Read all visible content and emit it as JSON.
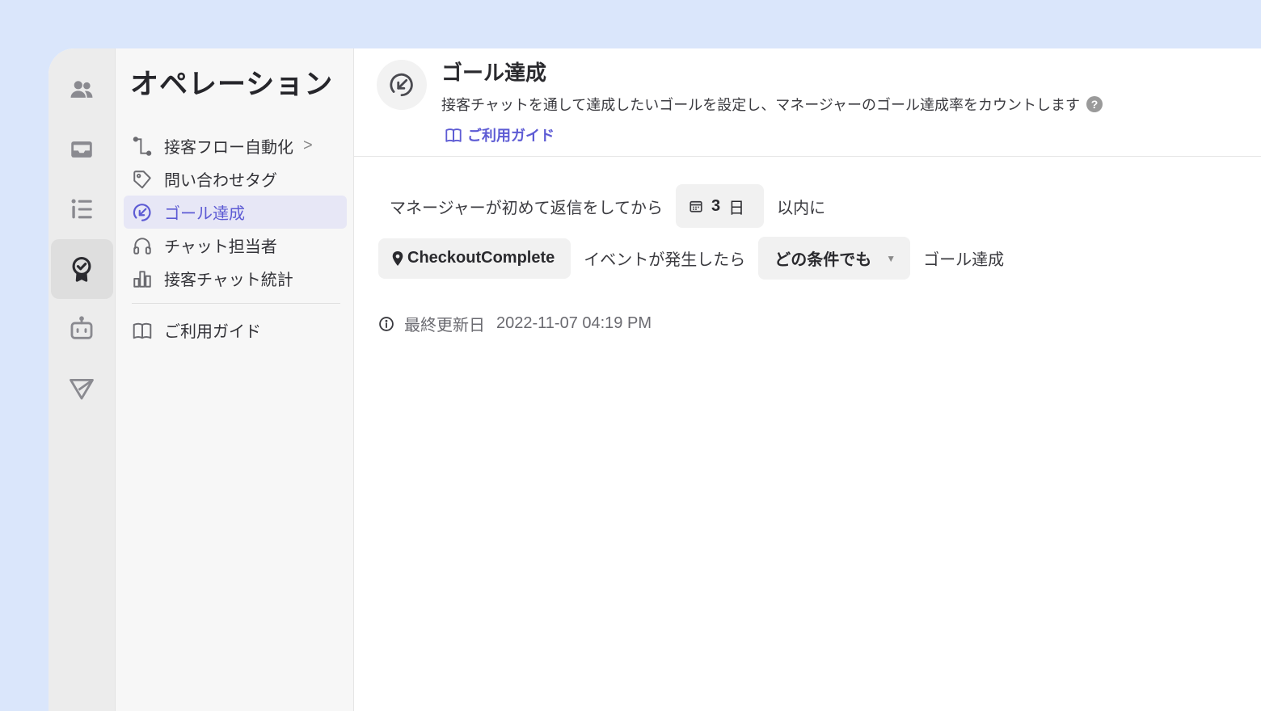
{
  "rail": {
    "items": [
      {
        "icon": "users-icon"
      },
      {
        "icon": "inbox-icon"
      },
      {
        "icon": "list-icon"
      },
      {
        "icon": "award-icon",
        "active": true
      },
      {
        "icon": "bot-icon"
      },
      {
        "icon": "send-icon"
      }
    ]
  },
  "sidebar": {
    "title": "オペレーション",
    "items": [
      {
        "label": "接客フロー自動化",
        "icon": "flow-icon",
        "chevron": ">"
      },
      {
        "label": "問い合わせタグ",
        "icon": "tag-icon"
      },
      {
        "label": "ゴール達成",
        "icon": "goal-icon",
        "active": true
      },
      {
        "label": "チャット担当者",
        "icon": "headset-icon"
      },
      {
        "label": "接客チャット統計",
        "icon": "bar-chart-icon"
      }
    ],
    "guide_label": "ご利用ガイド"
  },
  "header": {
    "title": "ゴール達成",
    "description": "接客チャットを通して達成したいゴールを設定し、マネージャーのゴール達成率をカウントします",
    "help": "?",
    "guide_link": "ご利用ガイド"
  },
  "rule": {
    "prefix": "マネージャーが初めて返信をしてから",
    "days_value": "3",
    "days_unit": "日",
    "within": "以内に",
    "event_name": "CheckoutComplete",
    "event_suffix": "イベントが発生したら",
    "condition": "どの条件でも",
    "result": "ゴール達成"
  },
  "updated": {
    "label": "最終更新日",
    "date": "2022-11-07 04:19 PM"
  },
  "colors": {
    "accent": "#5d5bd4",
    "background": "#dae6fb",
    "sidebar": "#f7f7f7",
    "rail": "#ececec"
  }
}
